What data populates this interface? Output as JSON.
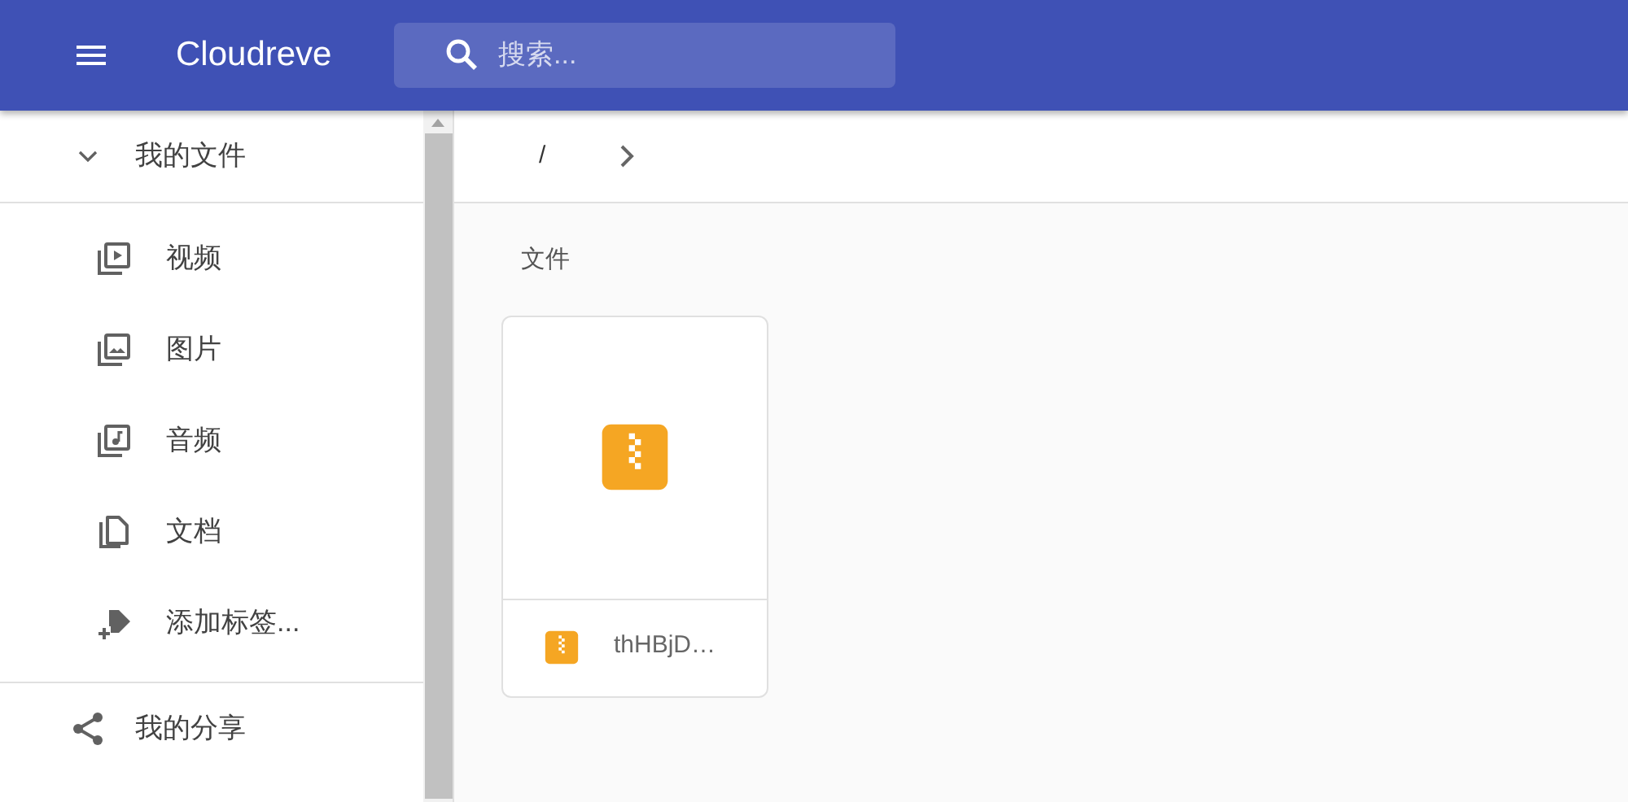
{
  "app_bar": {
    "title": "Cloudreve",
    "search": {
      "placeholder": "搜索..."
    }
  },
  "sidebar": {
    "sections": [
      {
        "label": "我的文件",
        "kind": "folder",
        "expanded": true,
        "children": [
          {
            "label": "视频",
            "kind": "video"
          },
          {
            "label": "图片",
            "kind": "image"
          },
          {
            "label": "音频",
            "kind": "audio"
          },
          {
            "label": "文档",
            "kind": "document"
          },
          {
            "label": "添加标签...",
            "kind": "tag"
          }
        ]
      },
      {
        "label": "我的分享",
        "kind": "share"
      }
    ]
  },
  "breadcrumb": {
    "path": "/"
  },
  "files_heading": "文件",
  "files": [
    {
      "name": "thHBjD…",
      "kind": "zip"
    }
  ]
}
